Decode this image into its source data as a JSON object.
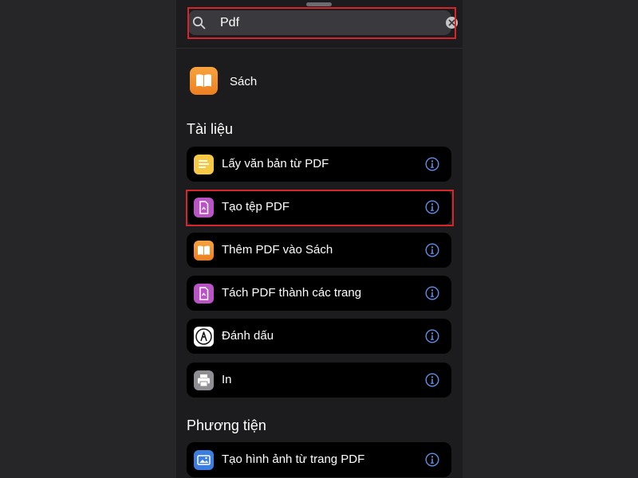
{
  "search": {
    "value": "Pdf"
  },
  "app_result": {
    "label": "Sách"
  },
  "sections": [
    {
      "title": "Tài liệu",
      "items": [
        {
          "label": "Lấy văn bản từ PDF",
          "icon": "notes-icon"
        },
        {
          "label": "Tạo tệp PDF",
          "icon": "pdf-file-icon"
        },
        {
          "label": "Thêm PDF vào Sách",
          "icon": "book-icon"
        },
        {
          "label": "Tách PDF thành các trang",
          "icon": "pdf-file-icon"
        },
        {
          "label": "Đánh dấu",
          "icon": "markup-pen-icon"
        },
        {
          "label": "In",
          "icon": "printer-icon"
        }
      ]
    },
    {
      "title": "Phương tiện",
      "items": [
        {
          "label": "Tạo hình ảnh từ trang PDF",
          "icon": "image-icon"
        }
      ]
    }
  ],
  "colors": {
    "background": "#1c1c1e",
    "row": "#000000",
    "accent_info": "#5a8fe8",
    "highlight": "#d7262b",
    "books_orange": "#f2902c",
    "notes_yellow": "#f6c945",
    "pdf_purple": "#b953c6",
    "photos_blue": "#3c7de0"
  }
}
